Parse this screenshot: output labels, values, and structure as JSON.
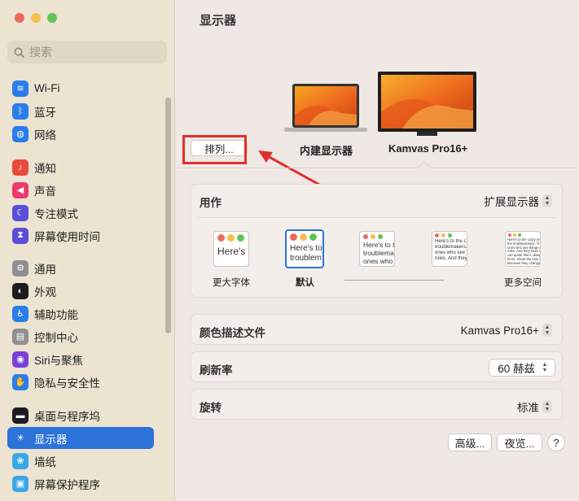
{
  "sidebar": {
    "search_placeholder": "搜索",
    "items": [
      {
        "label": "Wi-Fi",
        "icon": "wifi-icon",
        "color": "#2b7de9"
      },
      {
        "label": "蓝牙",
        "icon": "bluetooth-icon",
        "color": "#2b7de9"
      },
      {
        "label": "网络",
        "icon": "globe-icon",
        "color": "#2b7de9"
      },
      {
        "label": "通知",
        "icon": "bell-icon",
        "color": "#ea4a3c"
      },
      {
        "label": "声音",
        "icon": "speaker-icon",
        "color": "#ea3b6a"
      },
      {
        "label": "专注模式",
        "icon": "moon-icon",
        "color": "#5a4fd6"
      },
      {
        "label": "屏幕使用时间",
        "icon": "hourglass-icon",
        "color": "#5a4fd6"
      },
      {
        "label": "通用",
        "icon": "gear-icon",
        "color": "#8e8e93"
      },
      {
        "label": "外观",
        "icon": "appearance-icon",
        "color": "#1c1c1e"
      },
      {
        "label": "辅助功能",
        "icon": "accessibility-icon",
        "color": "#2b7de9"
      },
      {
        "label": "控制中心",
        "icon": "control-center-icon",
        "color": "#8e8e93"
      },
      {
        "label": "Siri与聚焦",
        "icon": "siri-icon",
        "color": "#7a3fd6"
      },
      {
        "label": "隐私与安全性",
        "icon": "hand-icon",
        "color": "#2b7de9"
      },
      {
        "label": "桌面与程序坞",
        "icon": "dock-icon",
        "color": "#1c1c1e"
      },
      {
        "label": "显示器",
        "icon": "sun-icon",
        "color": "#2b7de9"
      },
      {
        "label": "墙纸",
        "icon": "wallpaper-icon",
        "color": "#3aa7e8"
      },
      {
        "label": "屏幕保护程序",
        "icon": "screensaver-icon",
        "color": "#3aa7e8"
      }
    ],
    "selected_index": 14
  },
  "main": {
    "title": "显示器",
    "arrange_label": "排列...",
    "displays": [
      {
        "label": "内建显示器"
      },
      {
        "label": "Kamvas Pro16+"
      }
    ],
    "use_as": {
      "label": "用作",
      "value": "扩展显示器"
    },
    "resolutions": [
      {
        "label": "更大字体",
        "preview": "Here's"
      },
      {
        "label": "默认",
        "preview": "Here's to\ntroublem"
      },
      {
        "label": "",
        "preview": "Here's to t\ntroublemak\nones who"
      },
      {
        "label": "",
        "preview": "Here's to the c\ntroublemakers.\nones who see t\nrules. And they"
      },
      {
        "label": "更多空间",
        "preview": "Here's to the crazy ones\nthe troublemakers. The rou\nones who see things differ\nrules. And they have no re\ncan quote them, disagree\nthem. About the only thin\nBecause they change th"
      }
    ],
    "color_profile": {
      "label": "颜色描述文件",
      "value": "Kamvas Pro16+"
    },
    "refresh_rate": {
      "label": "刷新率",
      "value": "60 赫兹"
    },
    "rotation": {
      "label": "旋转",
      "value": "标准"
    },
    "advanced_label": "高级...",
    "night_shift_label": "夜览...",
    "help_label": "?"
  },
  "colors": {
    "accent": "#2b73d9",
    "annotation": "#e0302b"
  }
}
